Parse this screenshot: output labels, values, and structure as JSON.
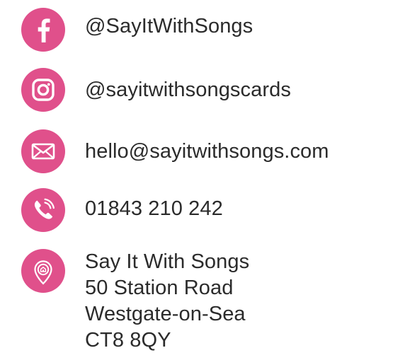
{
  "theme": {
    "accent": "#e0508b",
    "text": "#2b2b2b",
    "background": "#ffffff"
  },
  "contacts": {
    "facebook": {
      "icon": "facebook-icon",
      "text": "@SayItWithSongs"
    },
    "instagram": {
      "icon": "instagram-icon",
      "text": "@sayitwithsongscards"
    },
    "email": {
      "icon": "envelope-icon",
      "text": "hello@sayitwithsongs.com"
    },
    "phone": {
      "icon": "phone-icon",
      "text": "01843 210 242"
    },
    "address": {
      "icon": "location-pin-icon",
      "lines": [
        "Say It With Songs",
        "50 Station Road",
        "Westgate-on-Sea",
        "CT8 8QY"
      ]
    }
  }
}
